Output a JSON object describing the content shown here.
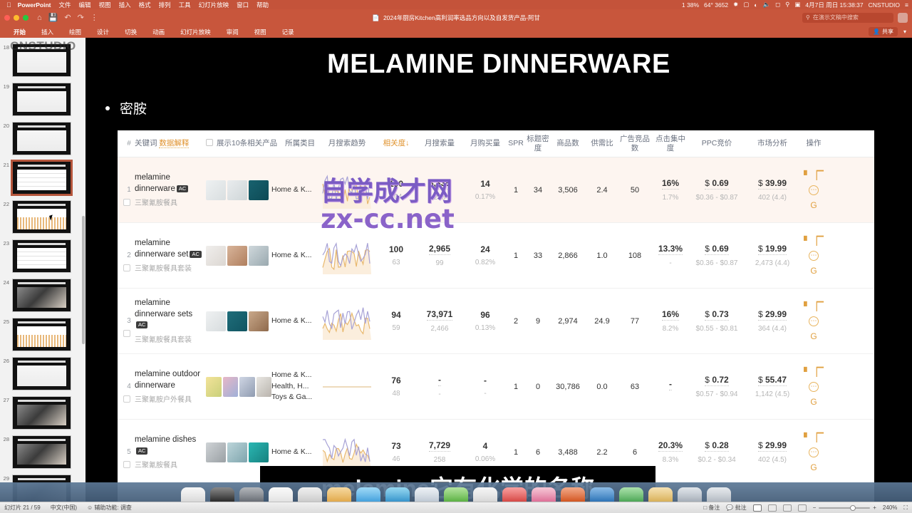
{
  "menubar": {
    "apple": "apple-logo",
    "items": [
      "PowerPoint",
      "文件",
      "编辑",
      "视图",
      "插入",
      "格式",
      "排列",
      "工具",
      "幻灯片放映",
      "窗口",
      "帮助"
    ],
    "right": [
      "1 38%",
      "64° 3652",
      "4月7日 周日 15:38:37",
      "CNSTUDIO"
    ]
  },
  "window": {
    "title": "2024年厨房Kitchen高利润率选品方向以及自发货产品-阿甘",
    "search_placeholder": "在演示文稿中搜索",
    "share_label": "共享"
  },
  "ribbon": {
    "tabs": [
      "开始",
      "插入",
      "绘图",
      "设计",
      "切换",
      "动画",
      "幻灯片放映",
      "审阅",
      "视图",
      "记录"
    ],
    "active": "开始"
  },
  "thumbnails": {
    "watermark": "CNSTUDIO",
    "selected": 21,
    "items": [
      {
        "num": "18",
        "style": "ui"
      },
      {
        "num": "19",
        "style": "ui"
      },
      {
        "num": "20",
        "style": "ui"
      },
      {
        "num": "21",
        "style": "grid"
      },
      {
        "num": "22",
        "style": "chart"
      },
      {
        "num": "23",
        "style": "grid"
      },
      {
        "num": "24",
        "style": "photo"
      },
      {
        "num": "25",
        "style": "chart"
      },
      {
        "num": "26",
        "style": "ui"
      },
      {
        "num": "27",
        "style": "photo"
      },
      {
        "num": "28",
        "style": "photo"
      },
      {
        "num": "29",
        "style": "photo"
      }
    ]
  },
  "slide": {
    "title": "MELAMINE DINNERWARE",
    "bullet": "密胺",
    "caption": "melamine它有化学的名称"
  },
  "table": {
    "headers": {
      "index": "#",
      "keyword": "关键词",
      "explain": "数据解释",
      "show_related": "展示10条相关产品",
      "category": "所属类目",
      "trend": "月搜索趋势",
      "relevance": "相关度",
      "sort_arrow": "↓",
      "search_volume": "月搜索量",
      "purchase_volume": "月购买量",
      "spr": "SPR",
      "title_density": "标题密度",
      "product_count": "商品数",
      "supply_demand": "供需比",
      "ad_competitors": "广告竞品数",
      "click_concentration": "点击集中度",
      "ppc_bid": "PPC竞价",
      "market_analysis": "市场分析",
      "actions": "操作"
    },
    "rows": [
      {
        "index": "1",
        "keyword": "melamine dinnerware",
        "badge": "AC",
        "keyword_cn": "三聚氰胺餐具",
        "categories": [
          "Home & K..."
        ],
        "relevance": "100",
        "relevance_sub": "104",
        "search_volume": "8,335",
        "search_volume_sub": "278",
        "purchase_volume": "14",
        "purchase_volume_sub": "0.17%",
        "spr": "1",
        "title_density": "34",
        "product_count": "3,506",
        "supply_demand": "2.4",
        "ad_competitors": "50",
        "click_concentration": "16%",
        "click_concentration_sub": "1.7%",
        "ppc_bid": "0.69",
        "ppc_range": "$0.36 - $0.87",
        "market_price": "39.99",
        "market_sub": "402 (4.4)",
        "highlight": true
      },
      {
        "index": "2",
        "keyword": "melamine dinnerware set",
        "badge": "AC",
        "keyword_cn": "三聚氰胺餐具套装",
        "categories": [
          "Home & K..."
        ],
        "relevance": "100",
        "relevance_sub": "63",
        "search_volume": "2,965",
        "search_volume_sub": "99",
        "purchase_volume": "24",
        "purchase_volume_sub": "0.82%",
        "spr": "1",
        "title_density": "33",
        "product_count": "2,866",
        "supply_demand": "1.0",
        "ad_competitors": "108",
        "click_concentration": "13.3%",
        "click_concentration_sub": "-",
        "ppc_bid": "0.69",
        "ppc_range": "$0.36 - $0.87",
        "market_price": "19.99",
        "market_sub": "2,473 (4.4)",
        "highlight": false
      },
      {
        "index": "3",
        "keyword": "melamine dinnerware sets",
        "badge": "AC",
        "keyword_cn": "三聚氰胺餐具套装",
        "categories": [
          "Home & K..."
        ],
        "relevance": "94",
        "relevance_sub": "59",
        "search_volume": "73,971",
        "search_volume_sub": "2,466",
        "purchase_volume": "96",
        "purchase_volume_sub": "0.13%",
        "spr": "2",
        "title_density": "9",
        "product_count": "2,974",
        "supply_demand": "24.9",
        "ad_competitors": "77",
        "click_concentration": "16%",
        "click_concentration_sub": "8.2%",
        "ppc_bid": "0.73",
        "ppc_range": "$0.55 - $0.81",
        "market_price": "29.99",
        "market_sub": "364 (4.4)",
        "highlight": false
      },
      {
        "index": "4",
        "keyword": "melamine outdoor dinnerware",
        "badge": "",
        "keyword_cn": "三聚氰胺户外餐具",
        "categories": [
          "Home & K...",
          "Health, H...",
          "Toys & Ga..."
        ],
        "relevance": "76",
        "relevance_sub": "48",
        "search_volume": "-",
        "search_volume_sub": "-",
        "purchase_volume": "-",
        "purchase_volume_sub": "-",
        "spr": "1",
        "title_density": "0",
        "product_count": "30,786",
        "supply_demand": "0.0",
        "ad_competitors": "63",
        "click_concentration": "-",
        "click_concentration_sub": "",
        "ppc_bid": "0.72",
        "ppc_range": "$0.57 - $0.94",
        "market_price": "55.47",
        "market_sub": "1,142 (4.5)",
        "highlight": false
      },
      {
        "index": "5",
        "keyword": "melamine dishes",
        "badge": "AC",
        "keyword_cn": "三聚氰胺餐具",
        "categories": [
          "Home & K..."
        ],
        "relevance": "73",
        "relevance_sub": "46",
        "search_volume": "7,729",
        "search_volume_sub": "258",
        "purchase_volume": "4",
        "purchase_volume_sub": "0.06%",
        "spr": "1",
        "title_density": "6",
        "product_count": "3,488",
        "supply_demand": "2.2",
        "ad_competitors": "6",
        "click_concentration": "20.3%",
        "click_concentration_sub": "8.3%",
        "ppc_bid": "0.28",
        "ppc_range": "$0.2 - $0.34",
        "market_price": "29.99",
        "market_sub": "402 (4.5)",
        "highlight": false
      }
    ]
  },
  "watermark": {
    "line1": "自学成才网",
    "line2": "zx-cc.net"
  },
  "statusbar": {
    "slide_count": "幻灯片 21 / 59",
    "language": "中文(中国)",
    "accessibility": "辅助功能: 调查",
    "notes": "备注",
    "comments": "批注",
    "zoom": "240%"
  },
  "colors": {
    "ribbon": "#c8563c",
    "accent": "#e0a040",
    "highlight_row": "#fdf5f0"
  }
}
